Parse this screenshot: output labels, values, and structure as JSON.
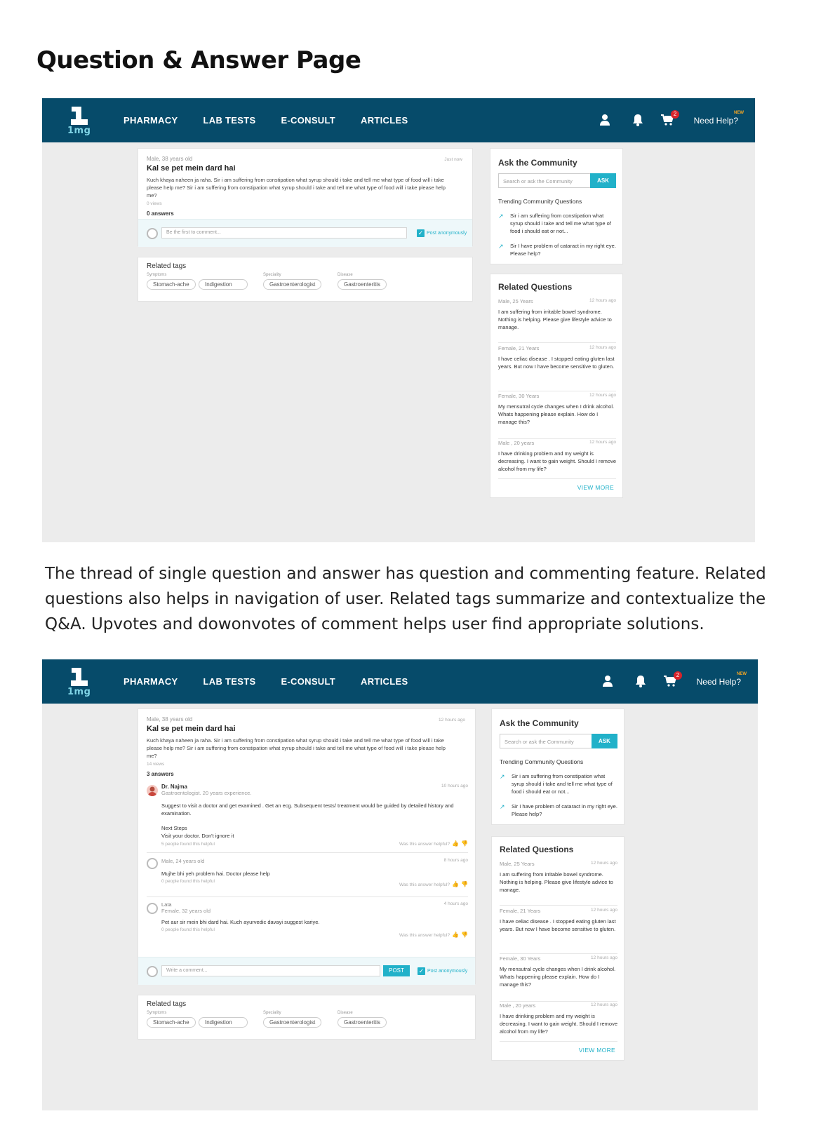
{
  "page_title": "Question & Answer Page",
  "description": "The thread of single question and answer has question and commenting feature. Related questions also helps in navigation of user. Related tags summarize and contextualize the Q&A. Upvotes and dowonvotes of comment helps user find appropriate solutions.",
  "nav": {
    "logo_text": "1mg",
    "links": [
      "PHARMACY",
      "LAB TESTS",
      "E-CONSULT",
      "ARTICLES"
    ],
    "cart_count": "2",
    "need_help": "Need Help?",
    "new_tag": "NEW",
    "icons": [
      "user-icon",
      "bell-icon",
      "cart-icon"
    ]
  },
  "question": {
    "meta": "Male, 38 years old",
    "title": "Kal se pet mein dard hai",
    "body": "Kuch khaya naheen ja raha. Sir i am suffering from constipation what syrup should i take and tell me what type of food will i take please help me? Sir i am suffering from constipation what syrup should i take and tell me what type of food will i take please help me?",
    "views_1": "0 views",
    "answers_1": "0 answers",
    "time_1": "Just now",
    "views_2": "14 views",
    "answers_2": "3 answers",
    "time_2": "12 hours ago"
  },
  "comment": {
    "placeholder_1": "Be the first to comment...",
    "placeholder_2": "Write a comment...",
    "post_anon": "Post anonymously",
    "post_button": "POST"
  },
  "answers": [
    {
      "name": "Dr. Najma",
      "sub": "Gastroentologist. 20 years experience.",
      "time": "10 hours ago",
      "text": "Suggest to visit a doctor and get examined . Get an ecg. Subsequent tests/ treatment would be guided by detailed history and examination.",
      "text2": "Next Steps",
      "text3": "Visit your doctor. Don't ignore it",
      "helpful": "5 people found this helpful"
    },
    {
      "name": "",
      "sub": "Male, 24 years old",
      "time": "8 hours ago",
      "text": "Mujhe bhi yeh problem hai. Doctor please help",
      "helpful": "0 people found this helpful"
    },
    {
      "name": "Lata",
      "sub": "Female, 32 years old",
      "time": "4 hours ago",
      "text": "Pet aur sir mein bhi dard hai. Kuch ayurvedic davayi suggest kariye.",
      "helpful": "0 people found this helpful"
    }
  ],
  "was_helpful": "Was this answer helpful?",
  "tags": {
    "title": "Related tags",
    "groups": [
      {
        "label": "Symptoms",
        "items": [
          "Stomach-ache",
          "Indigestion"
        ]
      },
      {
        "label": "Speciality",
        "items": [
          "Gastroenterologist"
        ]
      },
      {
        "label": "Disease",
        "items": [
          "Gastroenteritis"
        ]
      }
    ]
  },
  "community": {
    "title": "Ask the Community",
    "search_placeholder": "Search or ask the Community",
    "ask_button": "ASK",
    "trending_title": "Trending Community Questions",
    "trending": [
      "Sir i am suffering from constipation what syrup should i take and tell me what type of food i should eat or not...",
      "Sir I have problem of cataract in my right eye. Please help?"
    ]
  },
  "related": {
    "title": "Related Questions",
    "items": [
      {
        "who": "Male, 25 Years",
        "ago": "12 hours ago",
        "text": "I am suffering from irritable bowel syndrome. Nothing is helping. Please give lifestyle advice to manage."
      },
      {
        "who": "Female, 21 Years",
        "ago": "12 hours ago",
        "text": "I have celiac disease . I stopped eating gluten last years. But now I have become sensitive to gluten."
      },
      {
        "who": "Female, 30 Years",
        "ago": "12 hours ago",
        "text": "My mensutral cycle changes when I drink alcohol. Whats happening please explain. How do I manage this?"
      },
      {
        "who": "Male , 20 years",
        "ago": "12 hours ago",
        "text": "I have drinking problem and my weight is decreasing. I want to gain weight. Should I remove alcohol from my life?"
      }
    ],
    "view_more": "VIEW MORE"
  }
}
